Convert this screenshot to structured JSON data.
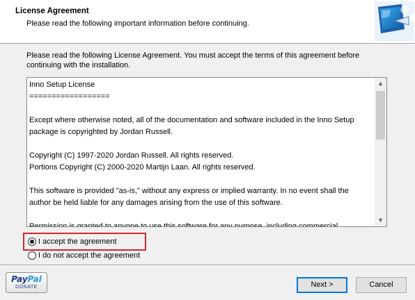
{
  "header": {
    "title": "License Agreement",
    "subtitle": "Please read the following important information before continuing."
  },
  "intro": "Please read the following License Agreement. You must accept the terms of this agreement before continuing with the installation.",
  "license": {
    "lines": [
      "Inno Setup License",
      "==================",
      "",
      "Except where otherwise noted, all of the documentation and software included in the Inno Setup",
      "package is copyrighted by Jordan Russell.",
      "",
      "Copyright (C) 1997-2020 Jordan Russell. All rights reserved.",
      "Portions Copyright (C) 2000-2020 Martijn Laan. All rights reserved.",
      "",
      "This software is provided \"as-is,\" without any express or implied warranty. In no event shall the",
      "author be held liable for any damages arising from the use of this software.",
      "",
      "Permission is granted to anyone to use this software for any purpose, including commercial"
    ],
    "scroll_position": 0.0
  },
  "options": {
    "accept_label": "I accept the agreement",
    "decline_label": "I do not accept the agreement",
    "selected": "accept"
  },
  "paypal": {
    "logo_a": "Pay",
    "logo_b": "Pal",
    "donate": "DONATE"
  },
  "buttons": {
    "next": "Next >",
    "cancel": "Cancel"
  },
  "colors": {
    "highlight": "#d0262e",
    "default_button_border": "#0078d7"
  }
}
